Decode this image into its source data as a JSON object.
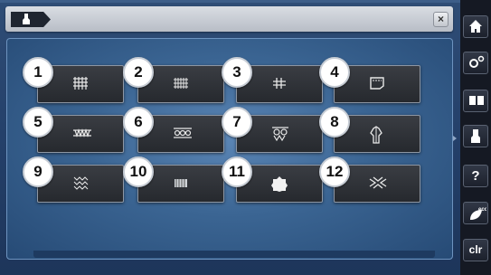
{
  "title_bar": {
    "tab_icon": "foot-icon",
    "close_label": "×"
  },
  "tiles": [
    {
      "number": "1",
      "icon": "stitch-grid-icon"
    },
    {
      "number": "2",
      "icon": "stitch-grid-dense-icon"
    },
    {
      "number": "3",
      "icon": "stitch-crosshatch-icon"
    },
    {
      "number": "4",
      "icon": "pocket-icon"
    },
    {
      "number": "5",
      "icon": "honeycomb-stitch-icon"
    },
    {
      "number": "6",
      "icon": "smocking-stitch-icon"
    },
    {
      "number": "7",
      "icon": "buttonhole-stitch-icon"
    },
    {
      "number": "8",
      "icon": "shirt-collar-icon"
    },
    {
      "number": "9",
      "icon": "darning-stitch-icon"
    },
    {
      "number": "10",
      "icon": "hem-stitch-icon"
    },
    {
      "number": "11",
      "icon": "patch-icon"
    },
    {
      "number": "12",
      "icon": "zigzag-stitch-icon"
    }
  ],
  "sidebar": {
    "home": "home-icon",
    "settings": "settings-icon",
    "tutorial": "book-icon",
    "presser_foot": "presser-foot-icon",
    "help_label": "?",
    "eco_label": "eco",
    "clear_label": "clr"
  }
}
